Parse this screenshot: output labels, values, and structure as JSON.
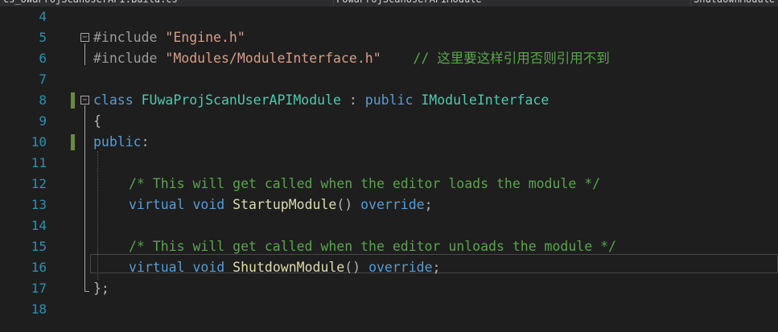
{
  "tabs": [
    {
      "label": "cs_UWaProjScanUserAPI.Build.cs"
    },
    {
      "label": "FUwaProjScanUserAPIModule"
    },
    {
      "label": "ShutdownModule"
    }
  ],
  "lines": {
    "l4": {
      "num": "4"
    },
    "l5": {
      "num": "5",
      "kw": "#include",
      "str": "\"Engine.h\""
    },
    "l6": {
      "num": "6",
      "kw": "#include",
      "str": "\"Modules/ModuleInterface.h\"",
      "comment": "// 这里要这样引用否则引用不到"
    },
    "l7": {
      "num": "7"
    },
    "l8": {
      "num": "8",
      "kw_class": "class",
      "class_name": "FUwaProjScanUserAPIModule",
      "colon": " : ",
      "kw_public": "public",
      "base": "IModuleInterface"
    },
    "l9": {
      "num": "9",
      "text": "{"
    },
    "l10": {
      "num": "10",
      "kw": "public",
      "punct": ":"
    },
    "l11": {
      "num": "11"
    },
    "l12": {
      "num": "12",
      "comment": "/* This will get called when the editor loads the module */"
    },
    "l13": {
      "num": "13",
      "kw_virtual": "virtual",
      "kw_void": "void",
      "fn": "StartupModule",
      "parens": "()",
      "kw_override": "override",
      "semi": ";"
    },
    "l14": {
      "num": "14"
    },
    "l15": {
      "num": "15",
      "comment": "/* This will get called when the editor unloads the module */"
    },
    "l16": {
      "num": "16",
      "kw_virtual": "virtual",
      "kw_void": "void",
      "fn": "ShutdownModule",
      "parens": "()",
      "kw_override": "override",
      "semi": ";"
    },
    "l17": {
      "num": "17",
      "text": "};"
    },
    "l18": {
      "num": "18"
    }
  }
}
